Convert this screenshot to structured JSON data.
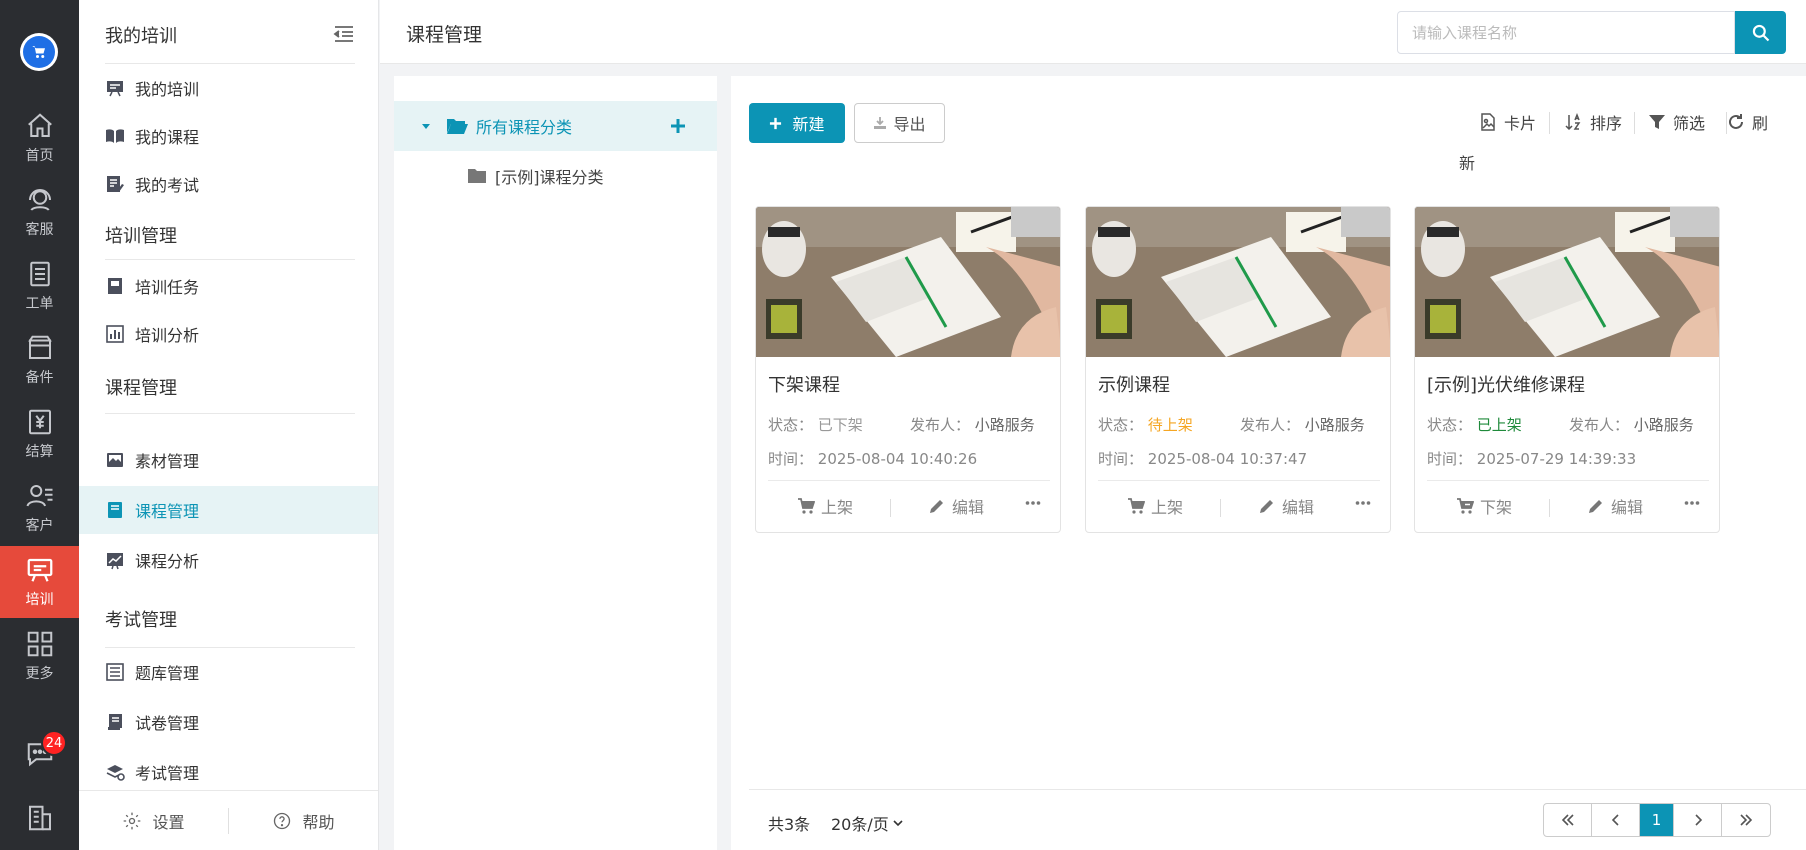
{
  "rail": {
    "items": [
      {
        "label": "首页",
        "icon": "home-icon"
      },
      {
        "label": "客服",
        "icon": "headset-icon"
      },
      {
        "label": "工单",
        "icon": "clipboard-icon"
      },
      {
        "label": "备件",
        "icon": "box-icon"
      },
      {
        "label": "结算",
        "icon": "yen-receipt-icon"
      },
      {
        "label": "客户",
        "icon": "user-list-icon"
      },
      {
        "label": "培训",
        "icon": "training-board-icon",
        "active": true
      },
      {
        "label": "更多",
        "icon": "grid-icon"
      }
    ],
    "message_badge": "24",
    "accent": "#e64a3b"
  },
  "submenu": {
    "title": "我的培训",
    "groups": {
      "g1": {
        "items": [
          "我的培训",
          "我的课程",
          "我的考试"
        ]
      },
      "g2": {
        "label": "培训管理",
        "items": [
          "培训任务",
          "培训分析"
        ]
      },
      "g3": {
        "label": "课程管理",
        "items": [
          "素材管理",
          "课程管理",
          "课程分析"
        ]
      },
      "g4": {
        "label": "考试管理",
        "items": [
          "题库管理",
          "试卷管理",
          "考试管理"
        ]
      }
    },
    "settings_label": "设置",
    "help_label": "帮助"
  },
  "topbar": {
    "title": "课程管理",
    "search_placeholder": "请输入课程名称"
  },
  "tree": {
    "root": "所有课程分类",
    "child": "[示例]课程分类"
  },
  "toolbar": {
    "new_label": "新建",
    "export_label": "导出",
    "card_label": "卡片",
    "sort_label": "排序",
    "filter_label": "筛选",
    "refresh_label_1": "刷",
    "refresh_label_2": "新"
  },
  "cards": [
    {
      "title": "下架课程",
      "status_label": "状态：",
      "status": "已下架",
      "status_color": "#999999",
      "publisher_label": "发布人：",
      "publisher": "小路服务",
      "time_label": "时间：",
      "time": "2025-08-04 10:40:26",
      "action1": "上架",
      "action2": "编辑"
    },
    {
      "title": "示例课程",
      "status_label": "状态：",
      "status": "待上架",
      "status_color": "#f5a623",
      "publisher_label": "发布人：",
      "publisher": "小路服务",
      "time_label": "时间：",
      "time": "2025-08-04 10:37:47",
      "action1": "上架",
      "action2": "编辑"
    },
    {
      "title": "[示例]光伏维修课程",
      "status_label": "状态：",
      "status": "已上架",
      "status_color": "#1f8a3b",
      "publisher_label": "发布人：",
      "publisher": "小路服务",
      "time_label": "时间：",
      "time": "2025-07-29 14:39:33",
      "action1": "下架",
      "action2": "编辑"
    }
  ],
  "pagination": {
    "total": "共3条",
    "per_page": "20条/页",
    "current_page": "1"
  },
  "colors": {
    "primary": "#0c94b5"
  }
}
